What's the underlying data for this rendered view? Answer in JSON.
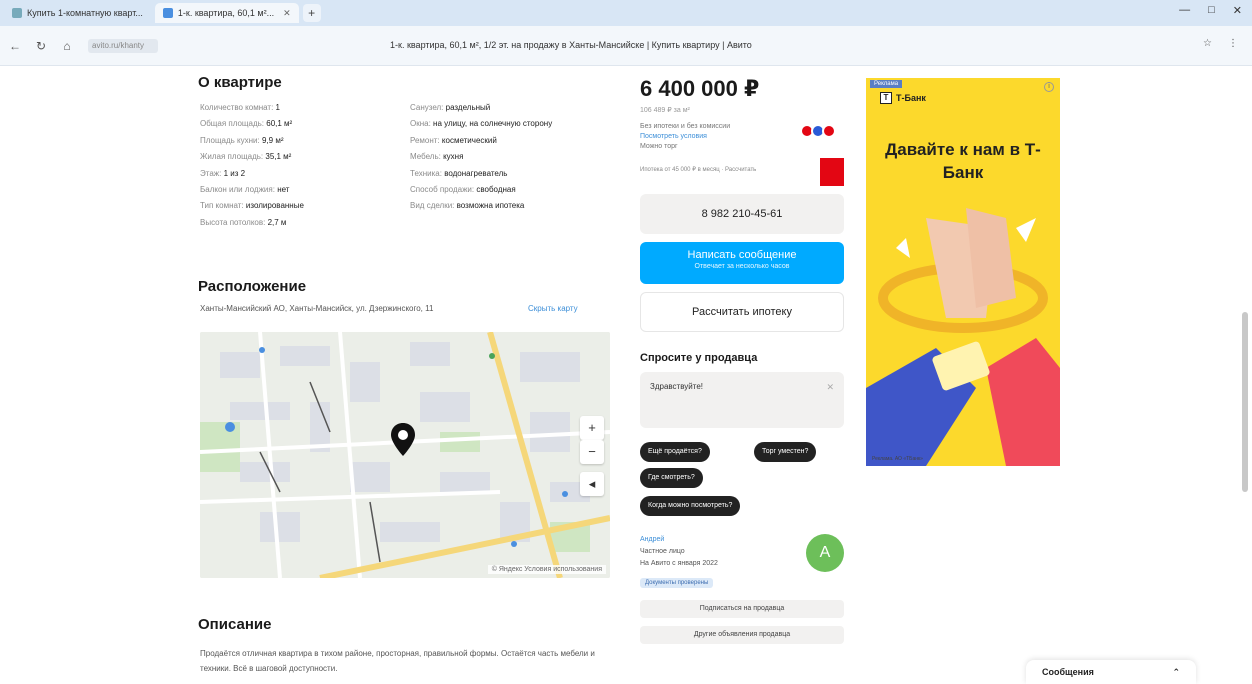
{
  "browser": {
    "tabs": [
      {
        "label": "Купить 1-комнатную кварт...",
        "active": false
      },
      {
        "label": "1-к. квартира, 60,1 м²...",
        "active": true
      }
    ],
    "new_tab": "+",
    "window_controls": [
      "—",
      "□",
      "✕"
    ],
    "url_chip": "avito.ru/khanty",
    "page_title": "1-к. квартира, 60,1 м², 1/2 эт. на продажу в Ханты-Мансийске | Купить квартиру | Авито",
    "right_tools": [
      "☆",
      "⋮"
    ]
  },
  "about": {
    "title": "О квартире",
    "left": [
      {
        "k": "Количество комнат:",
        "v": "1"
      },
      {
        "k": "Общая площадь:",
        "v": "60,1 м²"
      },
      {
        "k": "Площадь кухни:",
        "v": "9,9 м²"
      },
      {
        "k": "Жилая площадь:",
        "v": "35,1 м²"
      },
      {
        "k": "Этаж:",
        "v": "1 из 2"
      },
      {
        "k": "Балкон или лоджия:",
        "v": "нет"
      },
      {
        "k": "Тип комнат:",
        "v": "изолированные"
      },
      {
        "k": "Высота потолков:",
        "v": "2,7 м"
      }
    ],
    "right": [
      {
        "k": "Санузел:",
        "v": "раздельный"
      },
      {
        "k": "Окна:",
        "v": "на улицу, на солнечную сторону"
      },
      {
        "k": "Ремонт:",
        "v": "косметический"
      },
      {
        "k": "Мебель:",
        "v": "кухня"
      },
      {
        "k": "Техника:",
        "v": "водонагреватель"
      },
      {
        "k": "Способ продажи:",
        "v": "свободная"
      },
      {
        "k": "Вид сделки:",
        "v": "возможна ипотека"
      }
    ]
  },
  "location": {
    "title": "Расположение",
    "address": "Ханты-Мансийский АО, Ханты-Мансийск, ул. Дзержинского, 11",
    "show_map": "Скрыть карту",
    "map_copyright": "© Яндекс Условия использования",
    "map_controls": {
      "zoom_in": "+",
      "zoom_out": "−",
      "locate": "◂"
    }
  },
  "description": {
    "title": "Описание",
    "text": "Продаётся отличная квартира в тихом районе, просторная, правильной формы. Остаётся часть мебели и техники. Всё в шаговой доступности."
  },
  "sidebar": {
    "price": "6 400 000 ₽",
    "price_per_m": "106 489 ₽ за м²",
    "price_info_1": "Без ипотеки и без комиссии",
    "price_info_link": "Посмотреть условия",
    "price_info_2": "Можно торг",
    "mortgage_line": "Ипотека от 45 000 ₽ в месяц · Рассчитать",
    "phone_button": "8 982 210-45-61",
    "message_button": "Написать сообщение",
    "message_sub": "Отвечает за несколько часов",
    "mortgage_button": "Рассчитать ипотеку",
    "ask": {
      "title": "Спросите у продавца",
      "placeholder": "Здравствуйте!",
      "clear": "✕",
      "chips": [
        "Ещё продаётся?",
        "Торг уместен?",
        "Где смотреть?",
        "Когда можно посмотреть?"
      ]
    },
    "seller": {
      "name": "Андрей",
      "type": "Частное лицо",
      "since": "На Авито с января 2022",
      "badge": "Документы проверены",
      "avatar_letter": "А"
    },
    "subscribe_button": "Подписаться на продавца",
    "other_button": "Другие объявления продавца"
  },
  "ad": {
    "tag": "Реклама",
    "brand": "Т-Банк",
    "headline": "Давайте к нам в Т-Банк",
    "footer": "Реклама. АО «ТБанк»"
  },
  "messages": {
    "label": "Сообщения",
    "toggle": "⌃"
  },
  "colors": {
    "accent": "#00aaff",
    "link": "#3d8fd8",
    "ad_bg": "#fcd92c",
    "badge_red": "#e30613",
    "avatar": "#6dbf5a"
  }
}
